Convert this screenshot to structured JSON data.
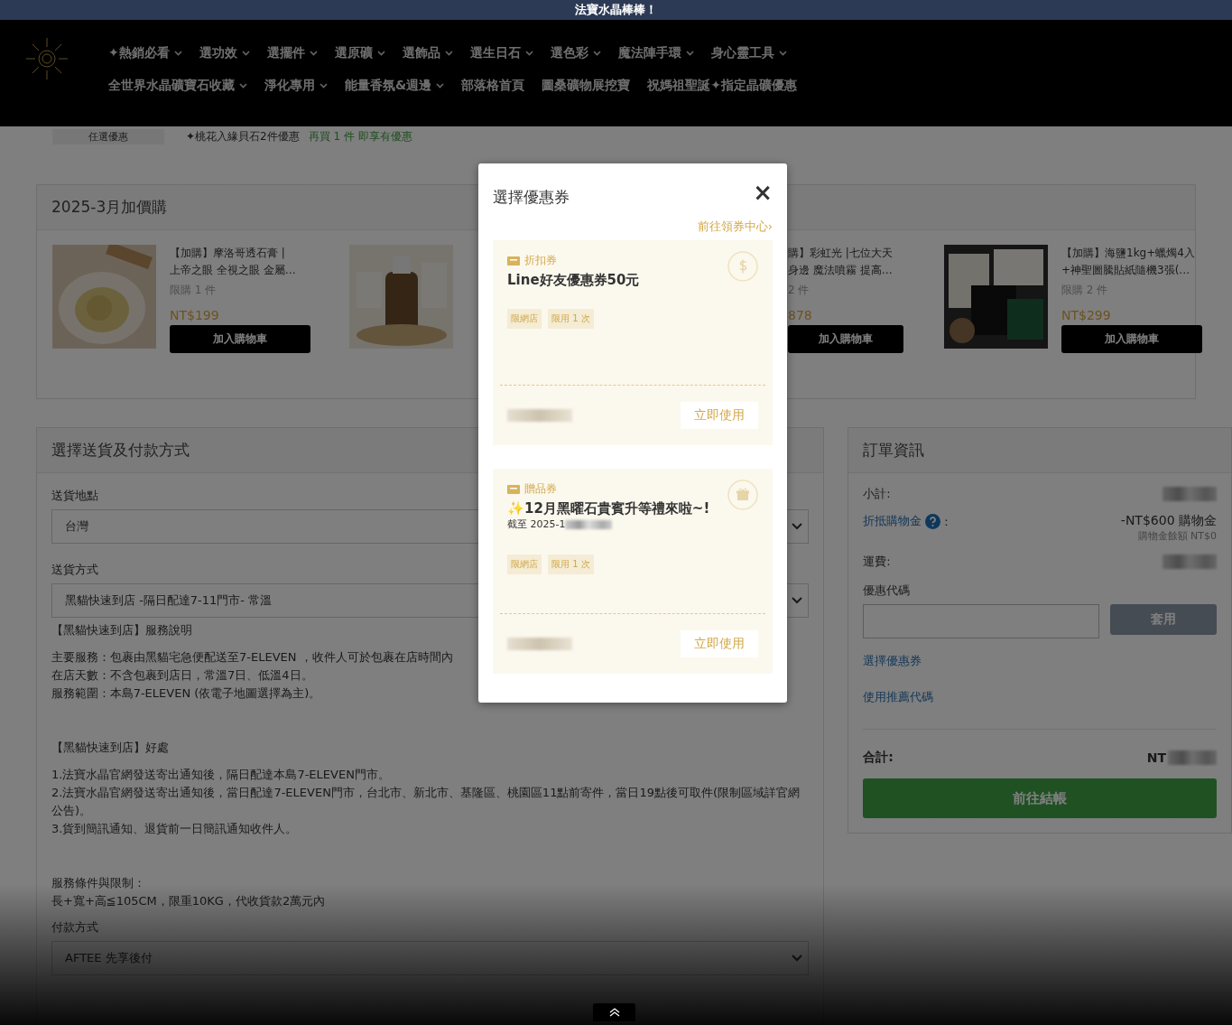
{
  "announcement": "法寶水晶棒棒！",
  "nav": {
    "primary": [
      {
        "label": "✦熱銷必看",
        "dropdown": true
      },
      {
        "label": "選功效",
        "dropdown": true
      },
      {
        "label": "選擺件",
        "dropdown": true
      },
      {
        "label": "選原礦",
        "dropdown": true
      },
      {
        "label": "選飾品",
        "dropdown": true
      },
      {
        "label": "選生日石",
        "dropdown": true
      },
      {
        "label": "選色彩",
        "dropdown": true
      },
      {
        "label": "魔法陣手環",
        "dropdown": true
      },
      {
        "label": "身心靈工具",
        "dropdown": true
      }
    ],
    "secondary": [
      {
        "label": "全世界水晶礦寶石收藏",
        "dropdown": true
      },
      {
        "label": "淨化專用",
        "dropdown": true
      },
      {
        "label": "能量香氛&週邊",
        "dropdown": true
      },
      {
        "label": "部落格首頁",
        "dropdown": false
      },
      {
        "label": "圖桑礦物展挖寶",
        "dropdown": false
      },
      {
        "label": "祝媽祖聖誕✦指定晶礦優惠",
        "dropdown": false
      }
    ]
  },
  "promo": {
    "label": "任選優惠",
    "text": "✦桃花入緣貝石2件優惠",
    "hint": "再買 1 件 即享有優惠"
  },
  "addons": {
    "title": "2025-3月加價購",
    "products": [
      {
        "kind": "full",
        "name_lines": [
          "【加購】摩洛哥透石膏 |",
          "上帝之眼 全視之眼 金屬…"
        ],
        "limit": "限購 1 件",
        "price": "NT$199",
        "button": "加入購物車"
      },
      {
        "kind": "picture_only"
      },
      {
        "kind": "text_only",
        "name_lines": [
          "購】彩虹光 |七位大天",
          "身邊 魔法噴霧 提高…"
        ],
        "limit": "2 件",
        "price": "878",
        "button": "加入購物車"
      },
      {
        "kind": "full",
        "name_lines": [
          "【加購】海鹽1kg+蠟燭4入",
          "+神聖圖騰貼紙隨機3張(…"
        ],
        "limit": "限購 2 件",
        "price": "NT$299",
        "button": "加入購物車"
      }
    ]
  },
  "shipping": {
    "title": "選擇送貨及付款方式",
    "fields": [
      {
        "label": "送貨地點",
        "value": "台灣"
      },
      {
        "label": "送貨方式",
        "value": "黑貓快速到店 -隔日配達7-11門市- 常溫"
      }
    ],
    "service_title": "【黑貓快速到店】服務說明",
    "service_lines": [
      "主要服務：包裹由黑貓宅急便配送至7-ELEVEN ，收件人可於包裹在店時間內",
      "在店天數：不含包裹到店日，常溫7日、低溫4日。",
      "服務範圍 : 本島7-ELEVEN (依電子地圖選擇為主)。"
    ],
    "benefit_title": "【黑貓快速到店】好處",
    "benefit_lines": [
      "1.法寶水晶官網發送寄出通知後，隔日配達本島7-ELEVEN門市。",
      "2.法寶水晶官網發送寄出通知後，當日配達7-ELEVEN門市，台北市、新北市、基隆區、桃園區11點前寄件，當日19點後可取件(限制區域詳官網公告)。",
      "3.貨到簡訊通知、退貨前一日簡訊通知收件人。"
    ],
    "terms_title": "服務條件與限制：",
    "terms_text": "長+寬+高≦105CM，限重10KG，代收貨款2萬元內",
    "payment": {
      "label": "付款方式",
      "value": "AFTEE 先享後付"
    }
  },
  "order": {
    "title": "訂單資訊",
    "subtotal_label": "小計:",
    "credit_label": "折抵購物金",
    "credit_colon": ":",
    "credit_value": "-NT$600 購物金",
    "credit_balance": "購物金餘額 NT$0",
    "shipping_label": "運費:",
    "code_label": "優惠代碼",
    "apply": "套用",
    "links": [
      "選擇優惠券",
      "使用推薦代碼"
    ],
    "total_label": "合計:",
    "total_prefix": "NT",
    "checkout": "前往結帳"
  },
  "modal": {
    "title": "選擇優惠券",
    "close": "×",
    "center_link": "前往領券中心›",
    "coupons": [
      {
        "kind": "discount",
        "type_label": "折扣券",
        "name": "Line好友優惠券50元",
        "tags": [
          "限網店",
          "限用 1 次"
        ],
        "action": "立即使用"
      },
      {
        "kind": "gift",
        "type_label": "贈品券",
        "name": "✨12月黑曜石貴賓升等禮來啦~!",
        "expiry": "截至 2025-1",
        "tags": [
          "限網店",
          "限用 1 次"
        ],
        "action": "立即使用"
      }
    ]
  }
}
